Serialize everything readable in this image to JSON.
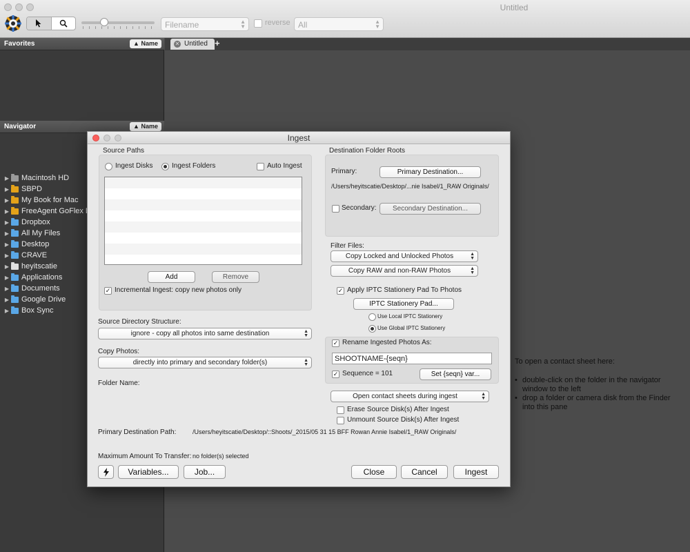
{
  "window": {
    "title": "Untitled",
    "toolbar": {
      "sort_field": "Filename",
      "reverse_label": "reverse",
      "filter_value": "All"
    }
  },
  "sidebar": {
    "favorites_header": "Favorites",
    "navigator_header": "Navigator",
    "sort_button": "▲ Name",
    "nav_items": [
      {
        "label": "Macintosh HD",
        "icon": "hard-drive-icon",
        "color": "#9a9a9a"
      },
      {
        "label": "SBPD",
        "icon": "external-drive-icon",
        "color": "#e3a21a"
      },
      {
        "label": "My Book for Mac",
        "icon": "external-drive-icon",
        "color": "#e3a21a"
      },
      {
        "label": "FreeAgent GoFlex Drive",
        "icon": "external-drive-icon",
        "color": "#e3a21a"
      },
      {
        "label": "Dropbox",
        "icon": "folder-icon",
        "color": "#5aa7e6"
      },
      {
        "label": "All My Files",
        "icon": "folder-icon",
        "color": "#5aa7e6"
      },
      {
        "label": "Desktop",
        "icon": "folder-icon",
        "color": "#5aa7e6"
      },
      {
        "label": "CRAVE",
        "icon": "folder-icon",
        "color": "#5aa7e6"
      },
      {
        "label": "heyitscatie",
        "icon": "home-icon",
        "color": "#e0e0e0"
      },
      {
        "label": "Applications",
        "icon": "folder-icon",
        "color": "#5aa7e6"
      },
      {
        "label": "Documents",
        "icon": "folder-icon",
        "color": "#5aa7e6"
      },
      {
        "label": "Google Drive",
        "icon": "folder-icon",
        "color": "#5aa7e6"
      },
      {
        "label": "Box Sync",
        "icon": "folder-icon",
        "color": "#5aa7e6"
      }
    ]
  },
  "tabs": {
    "active_label": "Untitled"
  },
  "content_hint": {
    "heading": "To open a contact sheet here:",
    "bullets": [
      "double-click on the folder in the navigator window to the left",
      "drop a folder or camera disk from the Finder into this pane"
    ]
  },
  "dialog": {
    "title": "Ingest",
    "source_paths": {
      "heading": "Source Paths",
      "ingest_disks": "Ingest Disks",
      "ingest_folders": "Ingest Folders",
      "auto_ingest": "Auto Ingest",
      "add": "Add",
      "remove": "Remove",
      "incremental": "Incremental Ingest: copy new photos only"
    },
    "source_dir_label": "Source Directory Structure:",
    "source_dir_value": "ignore - copy all photos into same destination",
    "copy_photos_label": "Copy Photos:",
    "copy_photos_value": "directly into primary and secondary folder(s)",
    "folder_name_label": "Folder Name:",
    "destination": {
      "heading": "Destination Folder Roots",
      "primary_label": "Primary:",
      "primary_button": "Primary Destination...",
      "primary_path": "/Users/heyitscatie/Desktop/...nie Isabel/1_RAW Originals/",
      "secondary_label": "Secondary:",
      "secondary_button": "Secondary Destination..."
    },
    "filter": {
      "label": "Filter Files:",
      "locked": "Copy Locked and Unlocked Photos",
      "raw": "Copy RAW and non-RAW Photos"
    },
    "iptc": {
      "apply": "Apply IPTC Stationery Pad To Photos",
      "button": "IPTC Stationery Pad...",
      "local": "Use Local IPTC Stationery",
      "global": "Use Global IPTC Stationery"
    },
    "rename": {
      "label": "Rename Ingested Photos As:",
      "value": "SHOOTNAME-{seqn}",
      "sequence": "Sequence = 101",
      "set_button": "Set {seqn} var..."
    },
    "open_contact": "Open contact sheets during ingest",
    "erase": "Erase Source Disk(s) After Ingest",
    "unmount": "Unmount Source Disk(s) After Ingest",
    "primary_path_label": "Primary Destination Path:",
    "primary_path_value": "/Users/heyitscatie/Desktop/::Shoots/_2015/05 31 15 BFF Rowan Annie Isabel/1_RAW Originals/",
    "max_transfer_label": "Maximum Amount To Transfer:",
    "max_transfer_value": "no folder(s) selected",
    "buttons": {
      "variables": "Variables...",
      "job": "Job...",
      "close": "Close",
      "cancel": "Cancel",
      "ingest": "Ingest"
    }
  },
  "colors": {
    "close_red": "#fc605c",
    "sidebar_bg": "#3a3a3a",
    "content_bg": "#4b4b4b",
    "dialog_bg": "#e8e8e8"
  }
}
